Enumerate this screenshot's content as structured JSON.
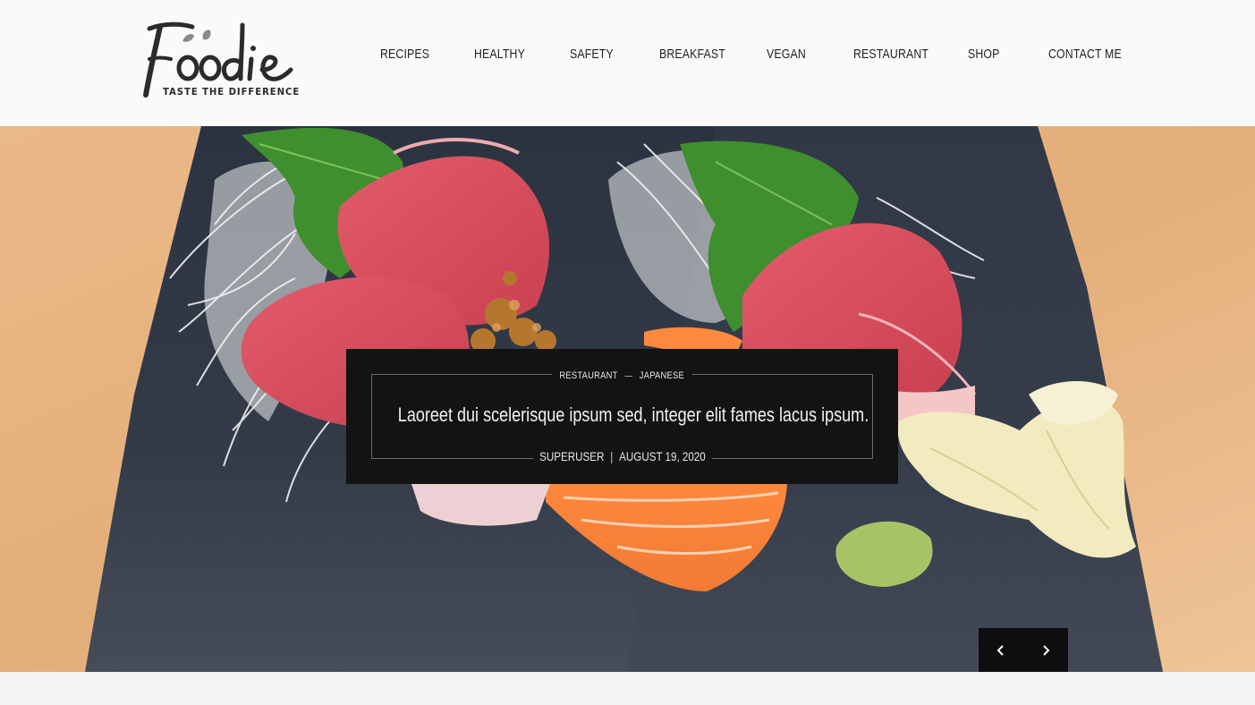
{
  "brand": {
    "logo_text": "Foodie",
    "tagline": "TASTE THE DIFFERENCE"
  },
  "nav": {
    "items": [
      {
        "label": "RECIPES"
      },
      {
        "label": "HEALTHY"
      },
      {
        "label": "SAFETY"
      },
      {
        "label": "BREAKFAST"
      },
      {
        "label": "VEGAN"
      },
      {
        "label": "RESTAURANT"
      },
      {
        "label": "SHOP"
      },
      {
        "label": "CONTACT ME"
      }
    ]
  },
  "slide": {
    "categories": [
      "RESTAURANT",
      "JAPANESE"
    ],
    "title": "Laoreet dui scelerisque ipsum sed, integer elit fames lacus ipsum.",
    "author": "SUPERUSER",
    "date": "AUGUST 19, 2020",
    "image": "sashimi-plate"
  },
  "slider_controls": {
    "prev_icon": "chevron-left-icon",
    "next_icon": "chevron-right-icon"
  },
  "colors": {
    "header_bg": "#fafafa",
    "caption_bg": "#131313",
    "page_bg": "#f3f3f3",
    "text_dark": "#222222"
  }
}
